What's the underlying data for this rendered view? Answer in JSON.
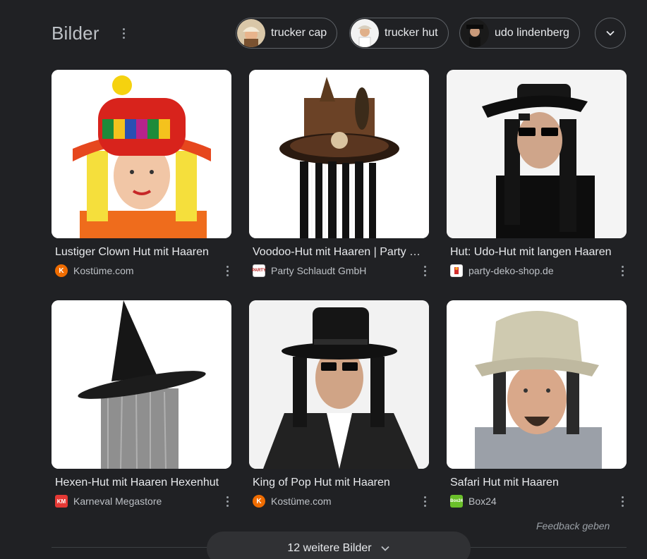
{
  "header": {
    "title": "Bilder",
    "chips": [
      {
        "label": "trucker cap"
      },
      {
        "label": "trucker hut"
      },
      {
        "label": "udo lindenberg"
      }
    ]
  },
  "results": [
    {
      "caption": "Lustiger Clown Hut mit Haaren",
      "source": "Kostüme.com",
      "favicon_text": "K",
      "favicon_color": "#ef6c00"
    },
    {
      "caption": "Voodoo-Hut mit Haaren | Party Schlaudt GmbH",
      "source": "Party Schlaudt GmbH",
      "favicon_text": "PARTY",
      "favicon_color": "#ffffff"
    },
    {
      "caption": "Hut: Udo-Hut mit langen Haaren",
      "source": "party-deko-shop.de",
      "favicon_text": "",
      "favicon_color": "#ffffff"
    },
    {
      "caption": "Hexen-Hut mit Haaren Hexenhut",
      "source": "Karneval Megastore",
      "favicon_text": "KM",
      "favicon_color": "#e53935"
    },
    {
      "caption": "King of Pop Hut mit Haaren",
      "source": "Kostüme.com",
      "favicon_text": "K",
      "favicon_color": "#ef6c00"
    },
    {
      "caption": "Safari Hut mit Haaren",
      "source": "Box24",
      "favicon_text": "Box24",
      "favicon_color": "#6abf2a"
    }
  ],
  "footer": {
    "feedback": "Feedback geben",
    "more_button": "12 weitere Bilder"
  }
}
